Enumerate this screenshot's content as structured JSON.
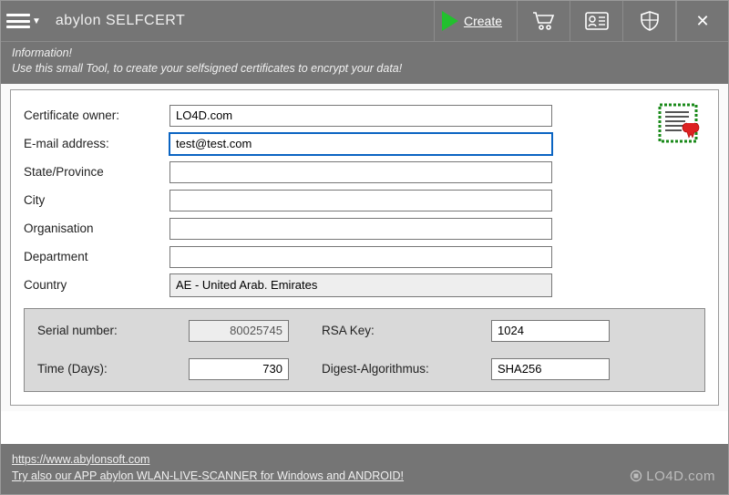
{
  "app": {
    "title": "abylon SELFCERT"
  },
  "toolbar": {
    "create_label": "Create"
  },
  "info": {
    "heading": "Information!",
    "text": "Use this small Tool, to create your selfsigned certificates to encrypt your data!"
  },
  "form": {
    "owner_label": "Certificate owner:",
    "owner_value": "LO4D.com",
    "email_label": "E-mail address:",
    "email_value": "test@test.com",
    "state_label": "State/Province",
    "state_value": "",
    "city_label": "City",
    "city_value": "",
    "org_label": "Organisation",
    "org_value": "",
    "dept_label": "Department",
    "dept_value": "",
    "country_label": "Country",
    "country_value": "AE - United Arab. Emirates"
  },
  "lower": {
    "serial_label": "Serial number:",
    "serial_value": "80025745",
    "time_label": "Time (Days):",
    "time_value": "730",
    "rsa_label": "RSA Key:",
    "rsa_value": "1024",
    "digest_label": "Digest-Algorithmus:",
    "digest_value": "SHA256"
  },
  "footer": {
    "link1": "https://www.abylonsoft.com",
    "link2": "Try also our APP abylon WLAN-LIVE-SCANNER for Windows and ANDROID!"
  },
  "watermark": "LO4D.com"
}
